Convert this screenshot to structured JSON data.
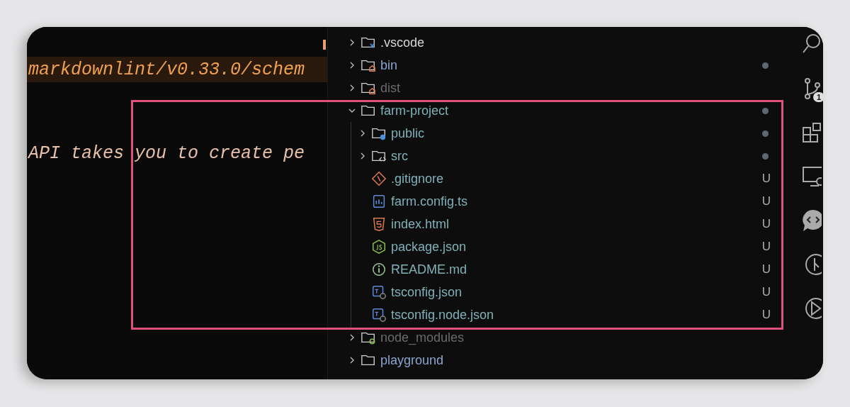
{
  "editor": {
    "lines": [
      {
        "text": "markdownlint/v0.33.0/schem",
        "highlighted": true
      },
      {
        "text": "API takes you to create pe",
        "highlighted": false
      }
    ]
  },
  "explorer": {
    "items": [
      {
        "name": ".vscode",
        "kind": "folder-vscode",
        "expanded": false,
        "color": "#d8d8d8",
        "dot": false
      },
      {
        "name": "bin",
        "kind": "folder-bin",
        "expanded": false,
        "color": "#8aa6d0",
        "dot": true
      },
      {
        "name": "dist",
        "kind": "folder-bin",
        "expanded": false,
        "color": "#6b6b6b",
        "dot": false
      },
      {
        "name": "farm-project",
        "kind": "folder",
        "expanded": true,
        "color": "#7fb1b9",
        "dot": true,
        "children": [
          {
            "name": "public",
            "kind": "folder-public",
            "expanded": false,
            "color": "#7fb1b9",
            "dot": true
          },
          {
            "name": "src",
            "kind": "folder-src",
            "expanded": false,
            "color": "#7fb1b9",
            "dot": true
          },
          {
            "name": ".gitignore",
            "kind": "gitignore",
            "color": "#7fb1b9",
            "status": "U"
          },
          {
            "name": "farm.config.ts",
            "kind": "config",
            "color": "#7fb1b9",
            "status": "U"
          },
          {
            "name": "index.html",
            "kind": "html",
            "color": "#7fb1b9",
            "status": "U"
          },
          {
            "name": "package.json",
            "kind": "js",
            "color": "#7fb1b9",
            "status": "U"
          },
          {
            "name": "README.md",
            "kind": "info",
            "color": "#7fb1b9",
            "status": "U"
          },
          {
            "name": "tsconfig.json",
            "kind": "tsconfig",
            "color": "#7fb1b9",
            "status": "U"
          },
          {
            "name": "tsconfig.node.json",
            "kind": "tsconfig",
            "color": "#7fb1b9",
            "status": "U"
          }
        ]
      },
      {
        "name": "node_modules",
        "kind": "folder-node",
        "expanded": false,
        "color": "#6b6b6b",
        "dot": false
      },
      {
        "name": "playground",
        "kind": "folder",
        "expanded": false,
        "color": "#8aa6d0",
        "dot": false
      }
    ]
  },
  "activity_bar": {
    "source_control_badge": "1"
  }
}
